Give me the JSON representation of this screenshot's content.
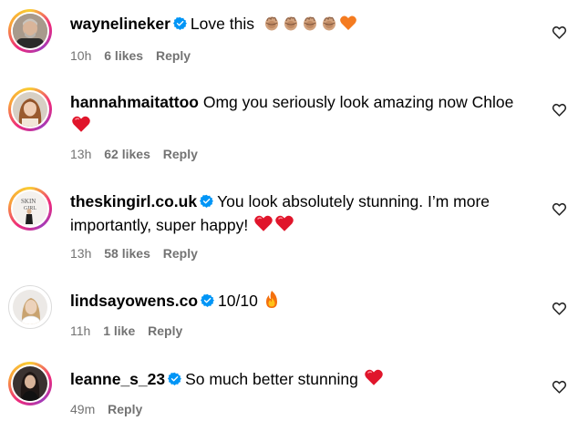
{
  "comments": [
    {
      "username": "waynelineker",
      "verified": true,
      "text": "Love this",
      "emojis": [
        "clap-medium-skin",
        "clap-medium-skin",
        "clap-medium-skin",
        "clap-medium-skin",
        "orange-heart"
      ],
      "time": "10h",
      "likes": "6 likes",
      "reply": "Reply"
    },
    {
      "username": "hannahmaitattoo",
      "verified": false,
      "text": "Omg you seriously look amazing now Chloe",
      "emojis": [
        "red-heart"
      ],
      "time": "13h",
      "likes": "62 likes",
      "reply": "Reply"
    },
    {
      "username": "theskingirl.co.uk",
      "verified": true,
      "text": "You look absolutely stunning. I’m more importantly, super happy!",
      "emojis": [
        "red-heart",
        "red-heart"
      ],
      "time": "13h",
      "likes": "58 likes",
      "reply": "Reply",
      "avatar_text": "SKIN GIRL"
    },
    {
      "username": "lindsayowens.co",
      "verified": true,
      "text": "10/10",
      "emojis": [
        "fire"
      ],
      "time": "11h",
      "likes": "1 like",
      "reply": "Reply"
    },
    {
      "username": "leanne_s_23",
      "verified": true,
      "text": "So much better stunning",
      "emojis": [
        "red-heart"
      ],
      "time": "49m",
      "likes": "",
      "reply": "Reply"
    }
  ],
  "colors": {
    "verified_blue": "#0095f6",
    "meta_gray": "#737373",
    "heart_red": "#e0152b",
    "heart_orange": "#f47b20"
  },
  "icons": {
    "like_button": "heart-outline-icon",
    "verified_badge": "verified-badge-icon"
  }
}
